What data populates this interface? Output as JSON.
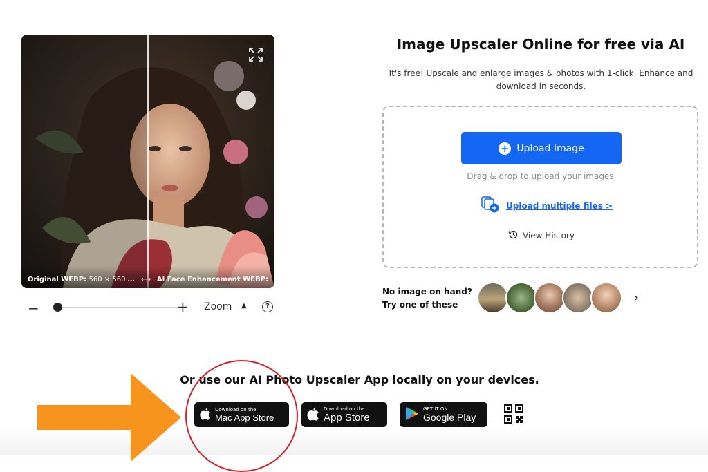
{
  "preview": {
    "original_caption_bold": "Original WEBP:",
    "original_caption_dim": "560 × 560 p...",
    "swap_symbol": "⟷",
    "ai_caption": "AI Face Enhancement WEBP:"
  },
  "zoom": {
    "minus": "−",
    "plus": "+",
    "label": "Zoom",
    "caret": "▲",
    "help": "?",
    "level": 0.0
  },
  "main": {
    "title": "Image Upscaler Online for free via AI",
    "subtitle": "It's free! Upscale and enlarge images & photos with 1-click. Enhance and download in seconds.",
    "upload_button": "Upload Image",
    "drag_text": "Drag & drop to upload your images",
    "multi_upload": "Upload multiple files >",
    "view_history": "View History"
  },
  "samples": {
    "prompt_line1": "No image on hand?",
    "prompt_line2": "Try one of these",
    "next": "›",
    "thumbs": [
      "car",
      "aerial-road",
      "child-portrait",
      "family",
      "woman-portrait"
    ]
  },
  "apps": {
    "heading": "Or use our AI Photo Upscaler App locally on your devices.",
    "mac_small": "Download on the",
    "mac_big": "Mac App Store",
    "ios_small": "Download on the",
    "ios_big": "App Store",
    "play_small": "GET IT ON",
    "play_big": "Google Play"
  },
  "colors": {
    "accent": "#1467f5",
    "annotation_arrow": "#f7941d",
    "annotation_circle": "#d2232a"
  }
}
